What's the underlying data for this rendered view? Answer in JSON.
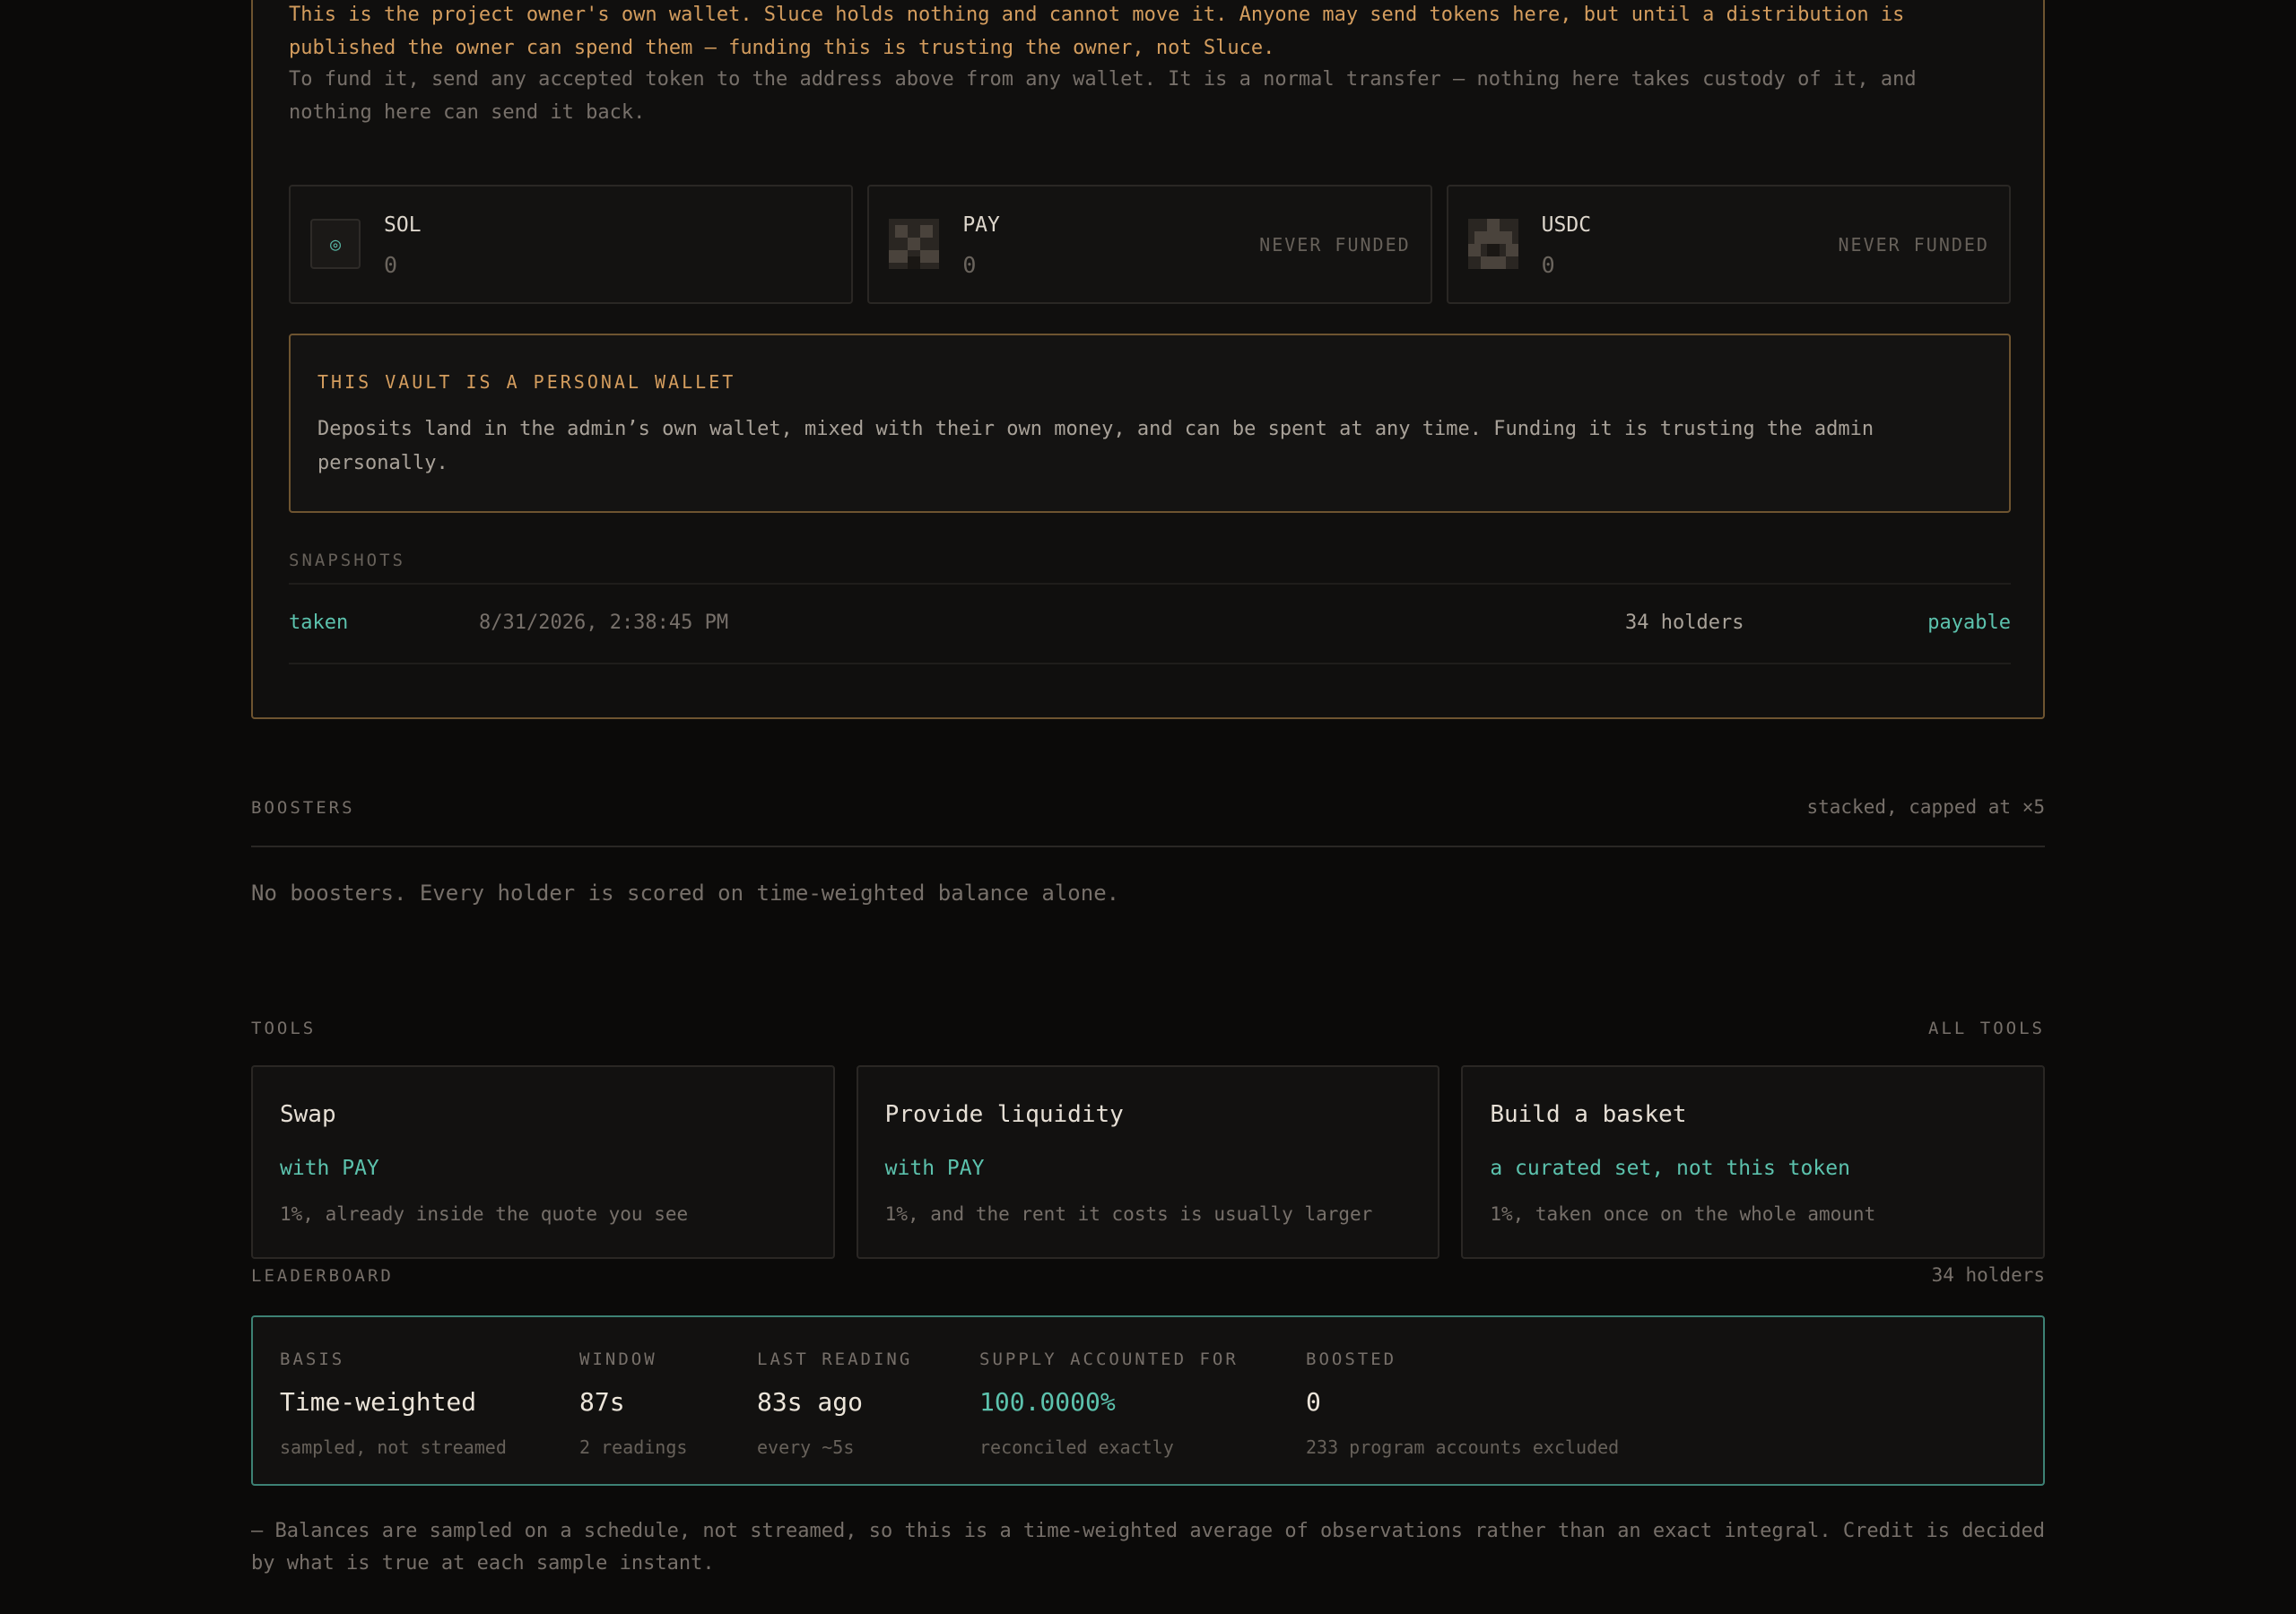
{
  "vault": {
    "warning": "This is the project owner's own wallet. Sluce holds nothing and cannot move it. Anyone may send tokens here, but until a distribution is published the owner can spend them — funding this is trusting the owner, not Sluce.",
    "funding_note": "To fund it, send any accepted token to the address above from any wallet. It is a normal transfer — nothing here takes custody of it, and nothing here can send it back.",
    "tokens": [
      {
        "name": "SOL",
        "amount": "0",
        "status": "",
        "icon": "sol-coin-icon"
      },
      {
        "name": "PAY",
        "amount": "0",
        "status": "NEVER FUNDED",
        "icon": "pixel-token-icon"
      },
      {
        "name": "USDC",
        "amount": "0",
        "status": "NEVER FUNDED",
        "icon": "pixel-token-icon"
      }
    ],
    "alert": {
      "title": "THIS VAULT IS A PERSONAL WALLET",
      "body": "Deposits land in the admin’s own wallet, mixed with their own money, and can be spent at any time. Funding it is trusting the admin personally."
    },
    "snapshots": {
      "label": "SNAPSHOTS",
      "rows": [
        {
          "status": "taken",
          "time": "8/31/2026, 2:38:45 PM",
          "holders": "34 holders",
          "state": "payable"
        }
      ]
    }
  },
  "boosters": {
    "label": "BOOSTERS",
    "cap_note": "stacked, capped at ×5",
    "empty_text": "No boosters. Every holder is scored on time-weighted balance alone."
  },
  "tools": {
    "label": "TOOLS",
    "all_link": "ALL TOOLS",
    "items": [
      {
        "title": "Swap",
        "with": "with PAY",
        "fee": "1%, already inside the quote you see"
      },
      {
        "title": "Provide liquidity",
        "with": "with PAY",
        "fee": "1%, and the rent it costs is usually larger"
      },
      {
        "title": "Build a basket",
        "with": "a curated set, not this token",
        "fee": "1%, taken once on the whole amount"
      }
    ]
  },
  "leaderboard": {
    "label": "LEADERBOARD",
    "holders": "34 holders",
    "stats": [
      {
        "label": "BASIS",
        "value": "Time-weighted",
        "sub": "sampled, not streamed"
      },
      {
        "label": "WINDOW",
        "value": "87s",
        "sub": "2 readings"
      },
      {
        "label": "LAST READING",
        "value": "83s ago",
        "sub": "every ~5s"
      },
      {
        "label": "SUPPLY ACCOUNTED FOR",
        "value": "100.0000%",
        "sub": "reconciled exactly"
      },
      {
        "label": "BOOSTED",
        "value": "0",
        "sub": "233 program accounts excluded"
      }
    ],
    "footnote": "— Balances are sampled on a schedule, not streamed, so this is a time-weighted average of observations rather than an exact integral. Credit is decided by what is true at each sample instant."
  },
  "colors": {
    "accent_teal": "#5cc2ad",
    "warning_amber": "#d49d5e",
    "vault_border": "#6e5430",
    "leaderboard_border": "#3d8174"
  }
}
